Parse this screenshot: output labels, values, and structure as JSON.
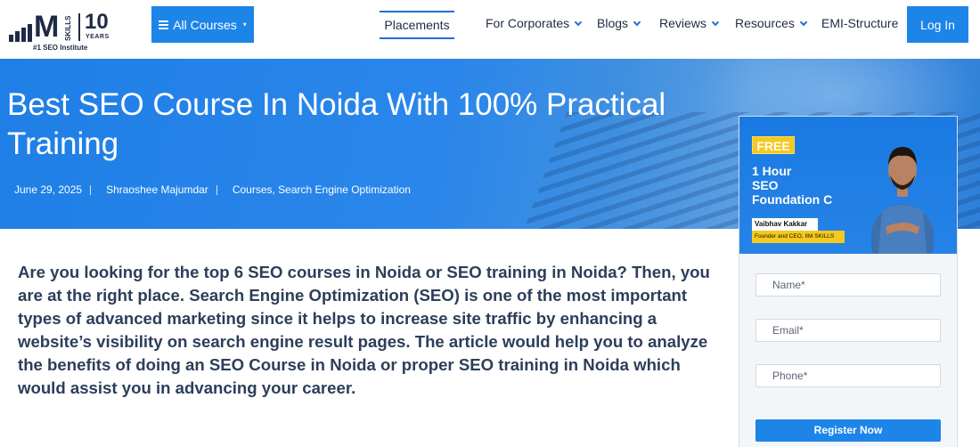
{
  "header": {
    "logo": {
      "brand": "M",
      "skills": "SKILLS",
      "years_num": "10",
      "years_label": "YEARS",
      "tagline": "#1 SEO Institute"
    },
    "all_courses_label": "All Courses",
    "nav": [
      {
        "label": "Placements",
        "active": true,
        "dropdown": false
      },
      {
        "label": "For Corporates",
        "dropdown": true
      },
      {
        "label": "Blogs",
        "dropdown": true
      },
      {
        "label": "Reviews",
        "dropdown": true
      },
      {
        "label": "Resources",
        "dropdown": true
      },
      {
        "label": "EMI-Structure",
        "dropdown": false
      }
    ],
    "login_label": "Log In"
  },
  "hero": {
    "title": "Best SEO Course In Noida With 100% Practical Training",
    "date": "June 29, 2025",
    "author": "Shraoshee Majumdar",
    "categories": "Courses, Search Engine Optimization"
  },
  "intro": "Are you looking for the top 6 SEO courses in Noida or SEO training in Noida? Then, you are at the right place. Search Engine Optimization (SEO) is one of the most important types of advanced marketing since it helps to increase site traffic by enhancing a website’s visibility on search engine result pages. The article would help you to analyze the benefits of doing an SEO Course in Noida or proper SEO training in Noida which would assist you in advancing your career.",
  "sidebar": {
    "badge": "FREE",
    "line1": "1 Hour",
    "line2": "SEO",
    "line3": "Foundation C",
    "speaker_name": "Vaibhav Kakkar",
    "speaker_role": "Founder and CEO, IIM SKILLS",
    "form": {
      "name_placeholder": "Name*",
      "email_placeholder": "Email*",
      "phone_placeholder": "Phone*",
      "submit_label": "Register Now"
    }
  },
  "colors": {
    "accent": "#1d84e8",
    "badge": "#f5c91d",
    "text_dark": "#2c3e5a"
  }
}
